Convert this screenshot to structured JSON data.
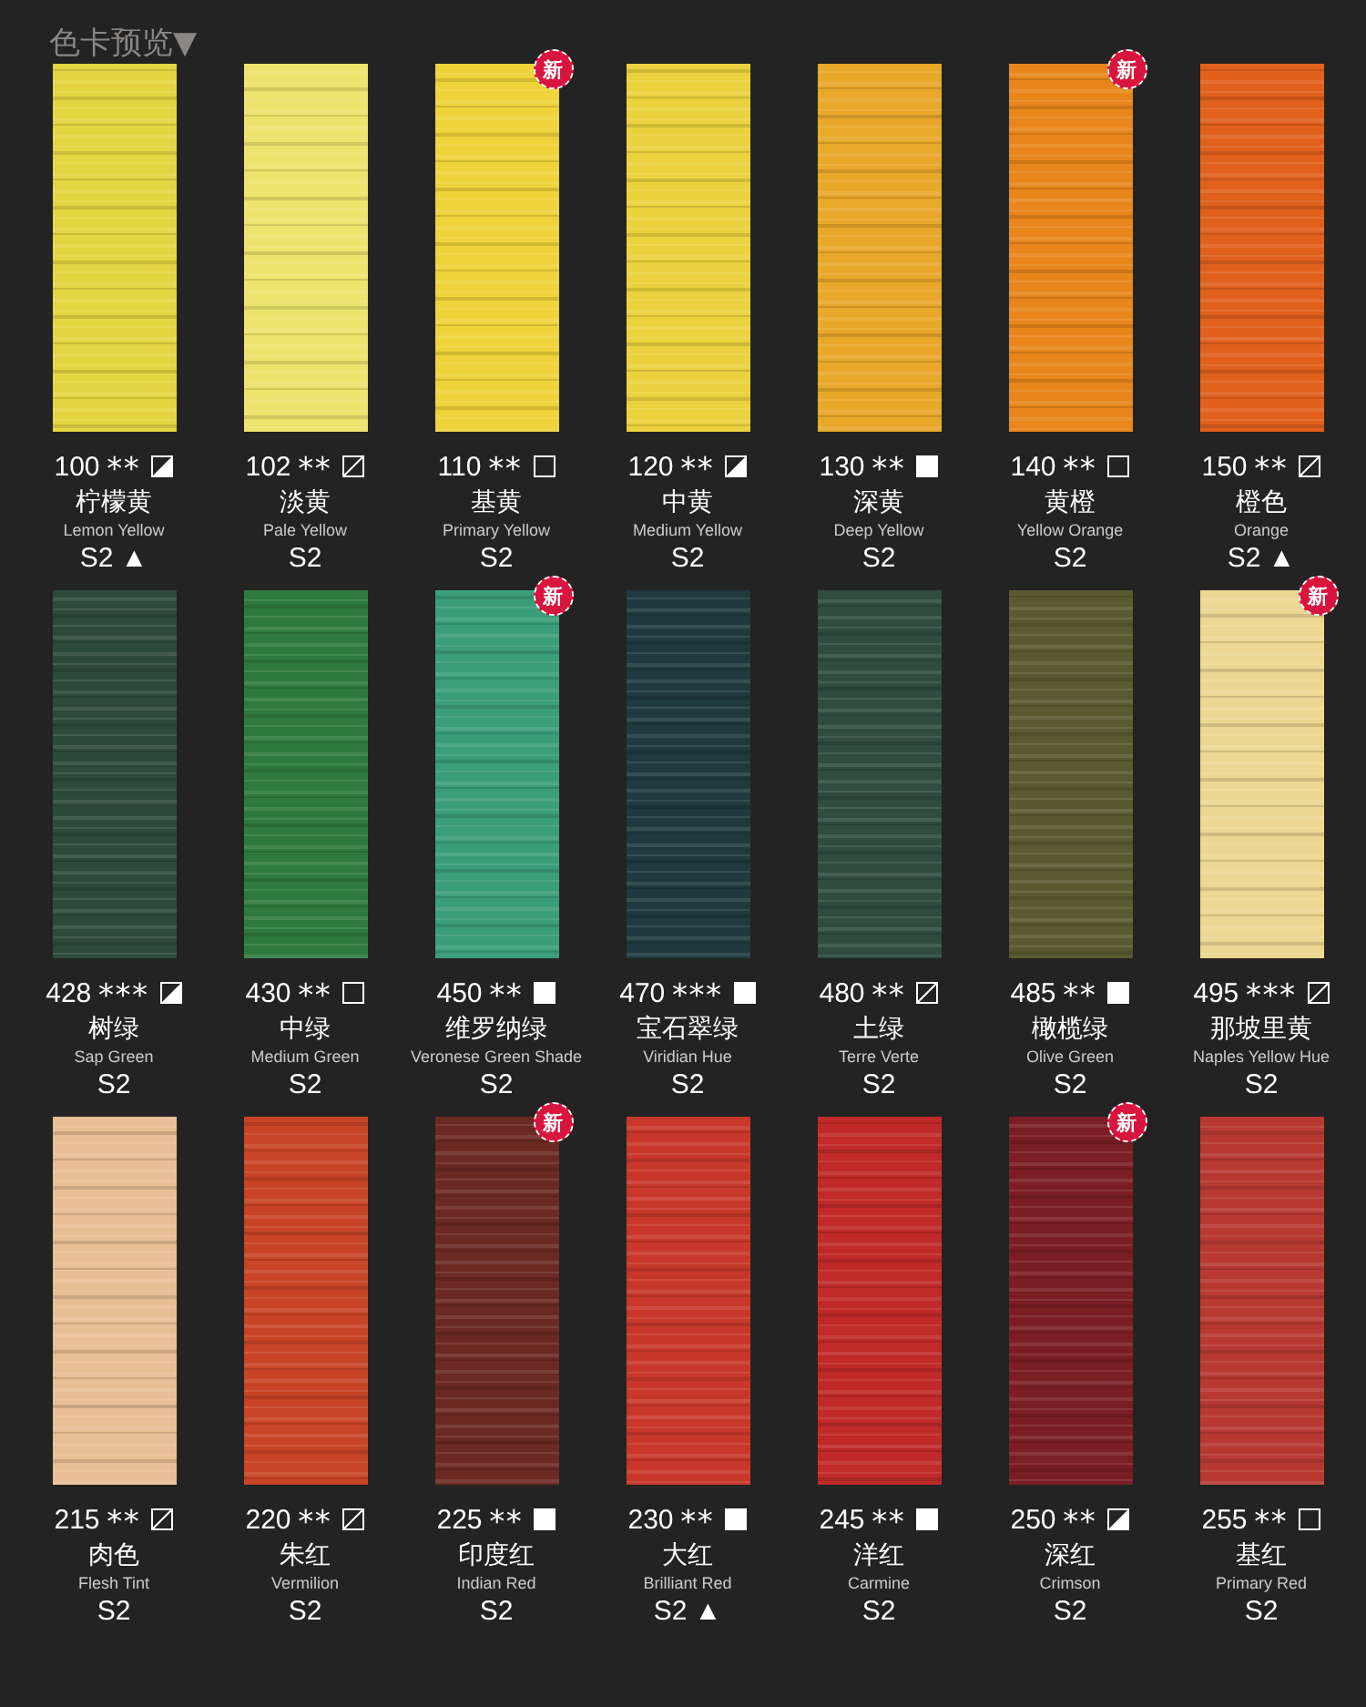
{
  "title": "色卡预览▼",
  "rows": [
    {
      "swatches": [
        {
          "code": "100",
          "stars": "**",
          "opacity": {
            "kind": "half"
          },
          "zh": "柠檬黄",
          "en": "Lemon Yellow",
          "series": "S2",
          "marker": "▲",
          "color": "#e6d542"
        },
        {
          "code": "102",
          "stars": "**",
          "opacity": {
            "kind": "slash"
          },
          "zh": "淡黄",
          "en": "Pale Yellow",
          "series": "S2",
          "color": "#ece46c"
        },
        {
          "code": "110",
          "stars": "**",
          "opacity": {
            "kind": "empty"
          },
          "zh": "基黄",
          "en": "Primary Yellow",
          "series": "S2",
          "badge": "新",
          "color": "#eed33a"
        },
        {
          "code": "120",
          "stars": "**",
          "opacity": {
            "kind": "half"
          },
          "zh": "中黄",
          "en": "Medium Yellow",
          "series": "S2",
          "color": "#ebd23e"
        },
        {
          "code": "130",
          "stars": "**",
          "opacity": {
            "kind": "filled"
          },
          "zh": "深黄",
          "en": "Deep Yellow",
          "series": "S2",
          "color": "#e8a82a"
        },
        {
          "code": "140",
          "stars": "**",
          "opacity": {
            "kind": "empty"
          },
          "zh": "黄橙",
          "en": "Yellow Orange",
          "series": "S2",
          "badge": "新",
          "color": "#e8861c"
        },
        {
          "code": "150",
          "stars": "**",
          "opacity": {
            "kind": "slash"
          },
          "zh": "橙色",
          "en": "Orange",
          "series": "S2",
          "marker": "▲",
          "color": "#e0601c"
        }
      ]
    },
    {
      "swatches": [
        {
          "code": "428",
          "stars": "***",
          "opacity": {
            "kind": "half"
          },
          "zh": "树绿",
          "en": "Sap Green",
          "series": "S2",
          "color": "#2c4a3a"
        },
        {
          "code": "430",
          "stars": "**",
          "opacity": {
            "kind": "empty"
          },
          "zh": "中绿",
          "en": "Medium Green",
          "series": "S2",
          "color": "#2e7a3e"
        },
        {
          "code": "450",
          "stars": "**",
          "opacity": {
            "kind": "filled"
          },
          "zh": "维罗纳绿",
          "en": "Veronese Green Shade",
          "series": "S2",
          "badge": "新",
          "color": "#3a9e7a"
        },
        {
          "code": "470",
          "stars": "***",
          "opacity": {
            "kind": "filled"
          },
          "zh": "宝石翠绿",
          "en": "Viridian Hue",
          "series": "S2",
          "color": "#1e3a3e"
        },
        {
          "code": "480",
          "stars": "**",
          "opacity": {
            "kind": "slash"
          },
          "zh": "土绿",
          "en": "Terre Verte",
          "series": "S2",
          "color": "#2e4c40"
        },
        {
          "code": "485",
          "stars": "**",
          "opacity": {
            "kind": "filled"
          },
          "zh": "橄榄绿",
          "en": "Olive Green",
          "series": "S2",
          "color": "#5a5a30"
        },
        {
          "code": "495",
          "stars": "***",
          "opacity": {
            "kind": "slash"
          },
          "zh": "那坡里黄",
          "en": "Naples Yellow Hue",
          "series": "S2",
          "badge": "新",
          "color": "#ecd892"
        }
      ]
    },
    {
      "swatches": [
        {
          "code": "215",
          "stars": "**",
          "opacity": {
            "kind": "slash"
          },
          "zh": "肉色",
          "en": "Flesh Tint",
          "series": "S2",
          "color": "#e8be96"
        },
        {
          "code": "220",
          "stars": "**",
          "opacity": {
            "kind": "slash"
          },
          "zh": "朱红",
          "en": "Vermilion",
          "series": "S2",
          "color": "#c84426"
        },
        {
          "code": "225",
          "stars": "**",
          "opacity": {
            "kind": "filled"
          },
          "zh": "印度红",
          "en": "Indian Red",
          "series": "S2",
          "badge": "新",
          "color": "#6a2a22"
        },
        {
          "code": "230",
          "stars": "**",
          "opacity": {
            "kind": "filled"
          },
          "zh": "大红",
          "en": "Brilliant Red",
          "series": "S2",
          "marker": "▲",
          "color": "#c8382a"
        },
        {
          "code": "245",
          "stars": "**",
          "opacity": {
            "kind": "filled"
          },
          "zh": "洋红",
          "en": "Carmine",
          "series": "S2",
          "color": "#c02a28"
        },
        {
          "code": "250",
          "stars": "**",
          "opacity": {
            "kind": "half"
          },
          "zh": "深红",
          "en": "Crimson",
          "series": "S2",
          "badge": "新",
          "color": "#7a1e24"
        },
        {
          "code": "255",
          "stars": "**",
          "opacity": {
            "kind": "empty"
          },
          "zh": "基红",
          "en": "Primary Red",
          "series": "S2",
          "color": "#b83832"
        }
      ]
    }
  ]
}
